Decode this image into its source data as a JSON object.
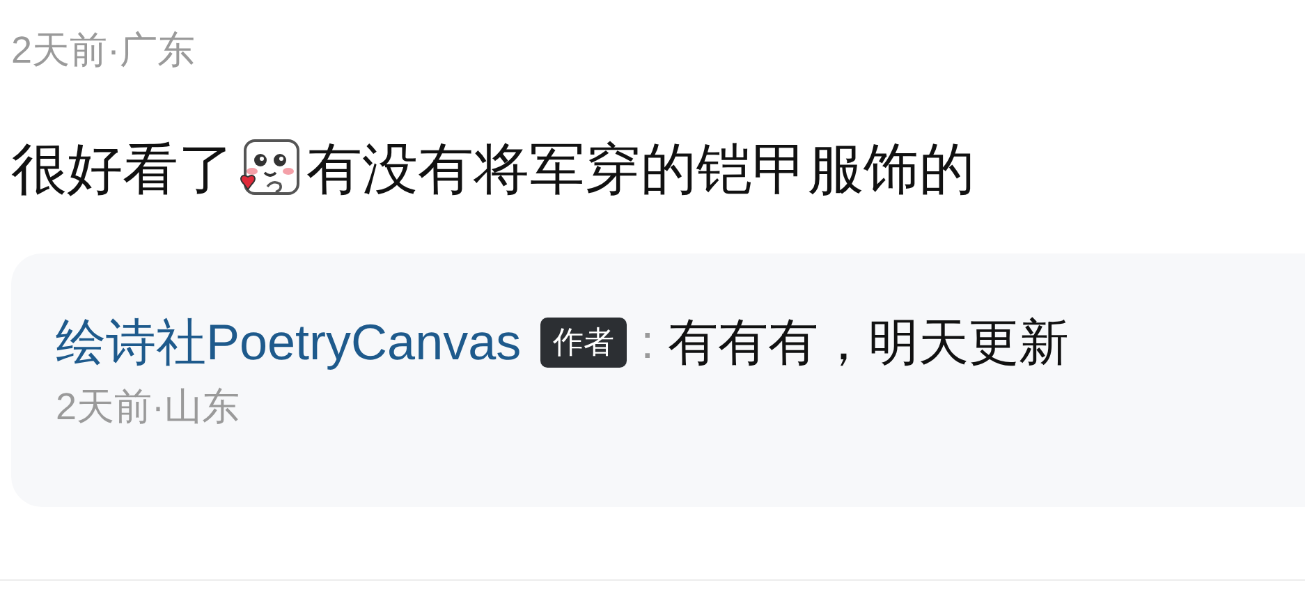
{
  "comment": {
    "meta": "2天前·广东",
    "text_before": "很好看了",
    "text_after": "有没有将军穿的铠甲服饰的",
    "reply": {
      "author": "绘诗社PoetryCanvas",
      "badge": "作者",
      "separator": ":",
      "text": "有有有，明天更新",
      "meta": "2天前·山东"
    }
  }
}
